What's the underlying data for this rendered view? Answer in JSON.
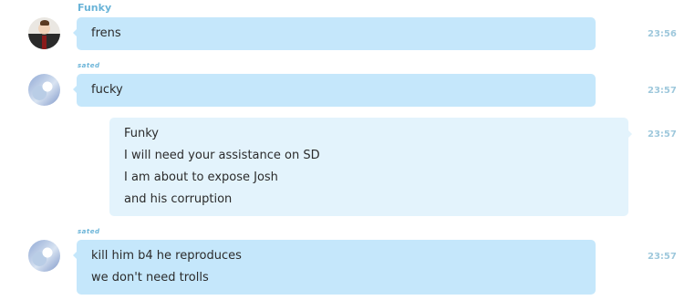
{
  "messages": [
    {
      "sender": "Funky",
      "lines": [
        "frens"
      ],
      "time": "23:56",
      "direction": "in"
    },
    {
      "sender": "sated",
      "lines": [
        "fucky"
      ],
      "time": "23:57",
      "direction": "in"
    },
    {
      "sender": "",
      "lines": [
        "Funky",
        "I will need your assistance on SD",
        "I am about to expose Josh",
        "and his corruption"
      ],
      "time": "23:57",
      "direction": "out"
    },
    {
      "sender": "sated",
      "lines": [
        "kill him b4 he reproduces",
        "we don't need trolls"
      ],
      "time": "23:57",
      "direction": "in"
    }
  ],
  "colors": {
    "incoming_bubble": "#c5e7fb",
    "outgoing_bubble": "#e3f3fc",
    "sender_name": "#6ab4d8",
    "timestamp": "#9ec8dc"
  }
}
